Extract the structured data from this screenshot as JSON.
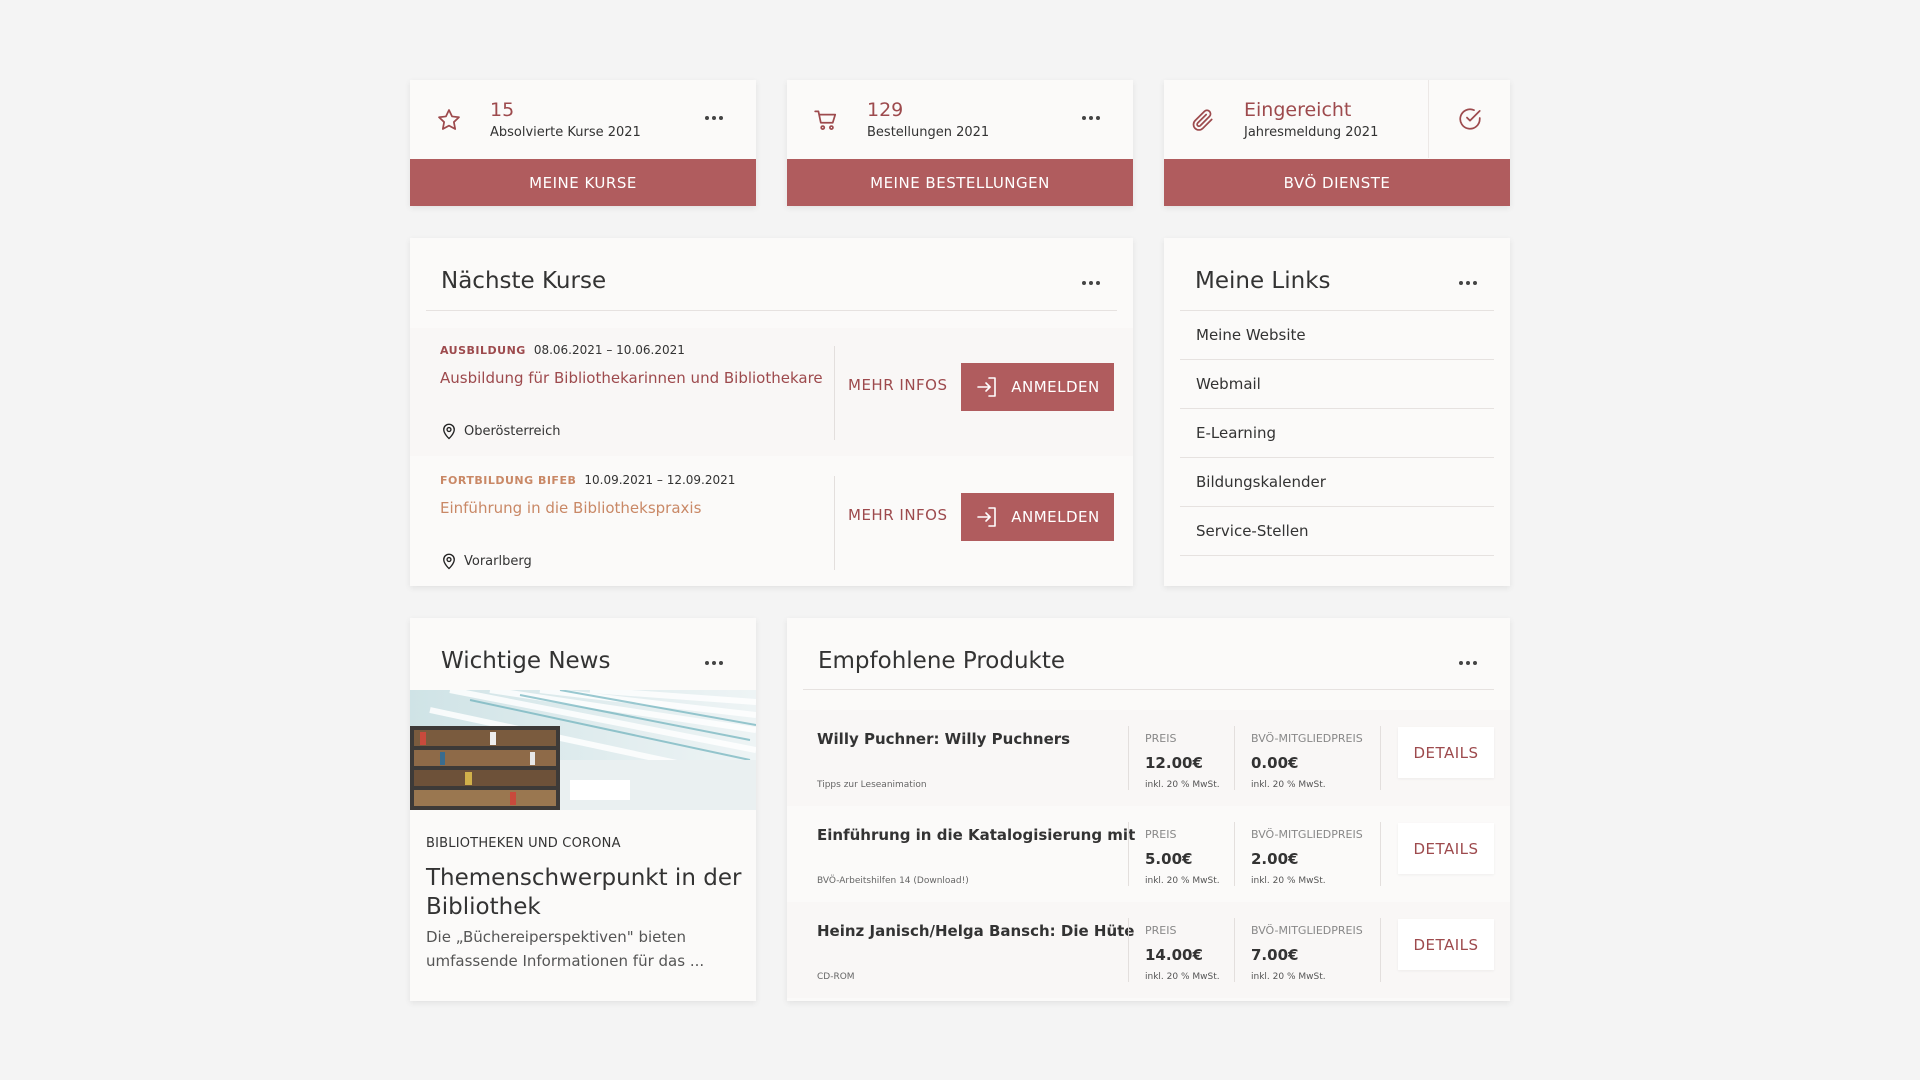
{
  "stats": [
    {
      "number": "15",
      "label": "Absolvierte Kurse 2021",
      "button": "MEINE KURSE",
      "icon": "star-icon"
    },
    {
      "number": "129",
      "label": "Bestellungen 2021",
      "button": "MEINE BESTELLUNGEN",
      "icon": "cart-icon"
    },
    {
      "number": "Eingereicht",
      "label": "Jahresmeldung 2021",
      "button": "BVÖ DIENSTE",
      "icon": "paperclip-icon"
    }
  ],
  "courses": {
    "title": "Nächste Kurse",
    "items": [
      {
        "tag": "AUSBILDUNG",
        "tag_color": "#9d4a4d",
        "date": "08.06.2021 – 10.06.2021",
        "name": "Ausbildung für Bibliothekarinnen und Bibliothekare",
        "name_color": "#9d4a4d",
        "location": "Oberösterreich",
        "more": "MEHR INFOS",
        "register": "ANMELDEN"
      },
      {
        "tag": "FORTBILDUNG BIFEB",
        "tag_color": "#c98866",
        "date": "10.09.2021 – 12.09.2021",
        "name": "Einführung in die Bibliothekspraxis",
        "name_color": "#c98866",
        "location": "Vorarlberg",
        "more": "MEHR INFOS",
        "register": "ANMELDEN"
      }
    ]
  },
  "links": {
    "title": "Meine Links",
    "items": [
      "Meine Website",
      "Webmail",
      "E-Learning",
      "Bildungskalender",
      "Service-Stellen"
    ]
  },
  "news": {
    "title": "Wichtige News",
    "category": "BIBLIOTHEKEN UND CORONA",
    "headline": "Themenschwerpunkt  in der Bibliothek",
    "text": "Die „Büchereiperspektiven\" bieten umfassende Informationen für das ..."
  },
  "products": {
    "title": "Empfohlene Produkte",
    "price_label": "PREIS",
    "member_label": "BVÖ-MITGLIEDPREIS",
    "tax_note": "inkl. 20 % MwSt.",
    "details": "DETAILS",
    "items": [
      {
        "name": "Willy Puchner: Willy Puchners",
        "sub": "Tipps zur Leseanimation",
        "price": "12.00€",
        "member_price": "0.00€"
      },
      {
        "name": "Einführung in die Katalogisierung mit",
        "sub": "BVÖ-Arbeitshilfen 14 (Download!)",
        "price": "5.00€",
        "member_price": "2.00€"
      },
      {
        "name": "Heinz Janisch/Helga Bansch: Die Hüte",
        "sub": "CD-ROM",
        "price": "14.00€",
        "member_price": "7.00€"
      }
    ]
  },
  "colors": {
    "accent": "#b05c5e",
    "accent_text": "#9d4a4d",
    "background": "#f4f4f4",
    "card": "#fbfaf9"
  }
}
